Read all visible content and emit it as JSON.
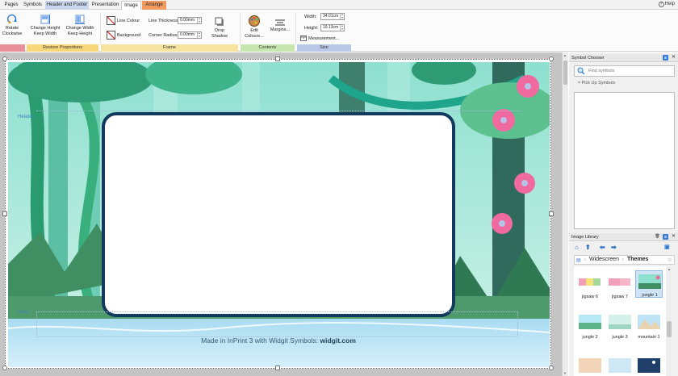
{
  "tabs": [
    {
      "label": "Pages"
    },
    {
      "label": "Symbols"
    },
    {
      "label": "Header and Footer"
    },
    {
      "label": "Presentation"
    },
    {
      "label": "Image"
    },
    {
      "label": "Arrange"
    }
  ],
  "help": {
    "label": "Help"
  },
  "ribbon": {
    "rotate": {
      "label": "Rotate Clockwise"
    },
    "change_height": {
      "label_1": "Change Height",
      "label_2": "Keep Width"
    },
    "change_width": {
      "label_1": "Change Width",
      "label_2": "Keep Height"
    },
    "line_colour": {
      "label": "Line Colour"
    },
    "background": {
      "label": "Background"
    },
    "line_thickness": {
      "label": "Line Thickness:",
      "value": "0.00mm"
    },
    "corner_radius": {
      "label": "Corner Radius:",
      "value": "0.00mm"
    },
    "drop_shadow": {
      "label_1": "Drop",
      "label_2": "Shadow"
    },
    "edit_colours": {
      "label_1": "Edit",
      "label_2": "Colours..."
    },
    "margins": {
      "label": "Margins..."
    },
    "width": {
      "label": "Width:",
      "value": "34.01cm"
    },
    "height": {
      "label": "Height:",
      "value": "19.13cm"
    },
    "measurement": {
      "label": "Measurement..."
    },
    "groups": {
      "restore": "Restore Proportions",
      "frame": "Frame",
      "contents": "Contents",
      "size": "Size"
    },
    "group_colors": {
      "rotate": "#e8909a",
      "restore": "#f7d77a",
      "frame": "#f7e3a0",
      "contents": "#c8e6b0",
      "size": "#b8c8e6"
    }
  },
  "canvas": {
    "header_label": "Header",
    "footer_label": "Footer",
    "credit_text": "Made in InPrint 3 with Widgit Symbols: ",
    "credit_brand": "widgit.com"
  },
  "symbol_chooser": {
    "title": "Symbol Chooser",
    "search_placeholder": "Find symbols",
    "pickup_label": "Pick Up Symbols"
  },
  "image_library": {
    "title": "Image Library",
    "crumb_1": "Widescreen",
    "crumb_2": "Themes",
    "items": [
      {
        "label": "jigsaw 6"
      },
      {
        "label": "jigsaw 7"
      },
      {
        "label": "jungle 1"
      },
      {
        "label": "jungle 2"
      },
      {
        "label": "jungle 3"
      },
      {
        "label": "mountain 1"
      }
    ]
  }
}
